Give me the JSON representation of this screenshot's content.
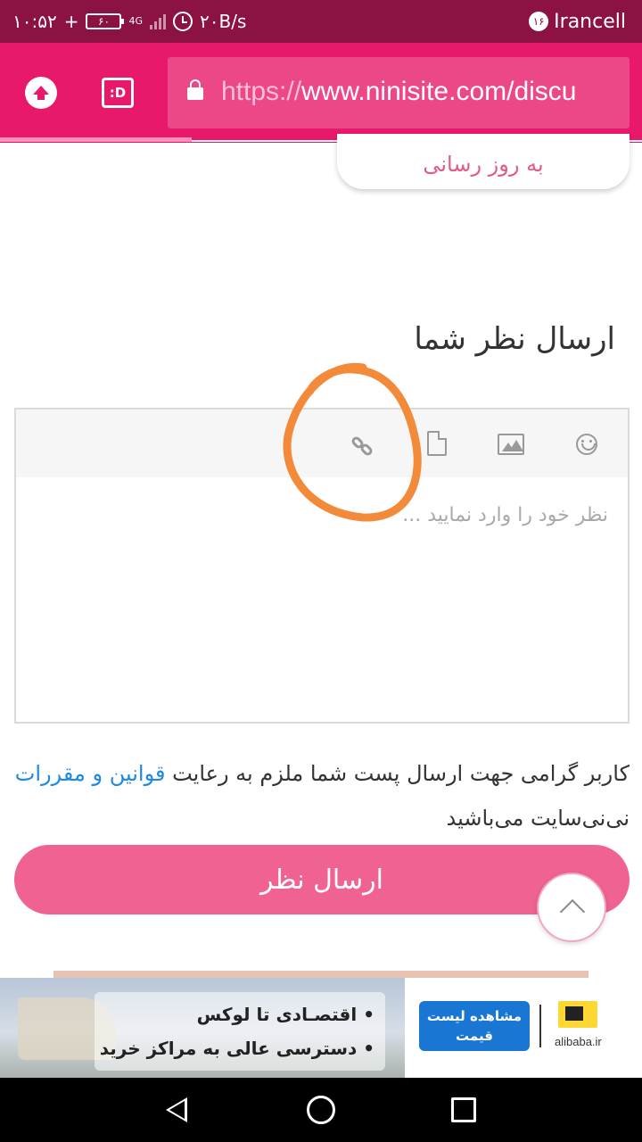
{
  "status_bar": {
    "time": "۱۰:۵۲",
    "plus": "+",
    "battery": "۶۰",
    "network_type": "4G",
    "speed": "۲۰B/s",
    "carrier": "Irancell",
    "sim_number": "۱۶"
  },
  "browser": {
    "url_scheme": "https://",
    "url_rest": "www.ninisite.com/discu",
    "d_button_label": ":D"
  },
  "page": {
    "update_button": "به روز رسانی",
    "section_title": "ارسال نظر شما",
    "editor_placeholder": "نظر خود را وارد نمایید ...",
    "notice_prefix": "کاربر گرامی جهت ارسال پست شما ملزم به رعایت ",
    "notice_link": "قوانین و مقررات",
    "notice_suffix": " نی‌نی‌سایت می‌باشید",
    "submit_button": "ارسال نظر"
  },
  "ad": {
    "line1": "اقتصـادی تا لوکس",
    "line2": "دسترسی عالی به مراکز خرید",
    "cta": "مشاهده لیست قیمت",
    "brand": "alibaba.ir"
  },
  "colors": {
    "status_bar": "#8b1243",
    "browser_bar": "#e8196a",
    "accent_pink": "#f06292",
    "link_blue": "#1e88e5",
    "annotation_orange": "#f28a3a"
  },
  "icons": [
    "upload-icon",
    "lock-icon",
    "link-icon",
    "file-icon",
    "image-icon",
    "emoji-icon",
    "chevron-up-icon",
    "back-icon",
    "home-icon",
    "recents-icon"
  ]
}
